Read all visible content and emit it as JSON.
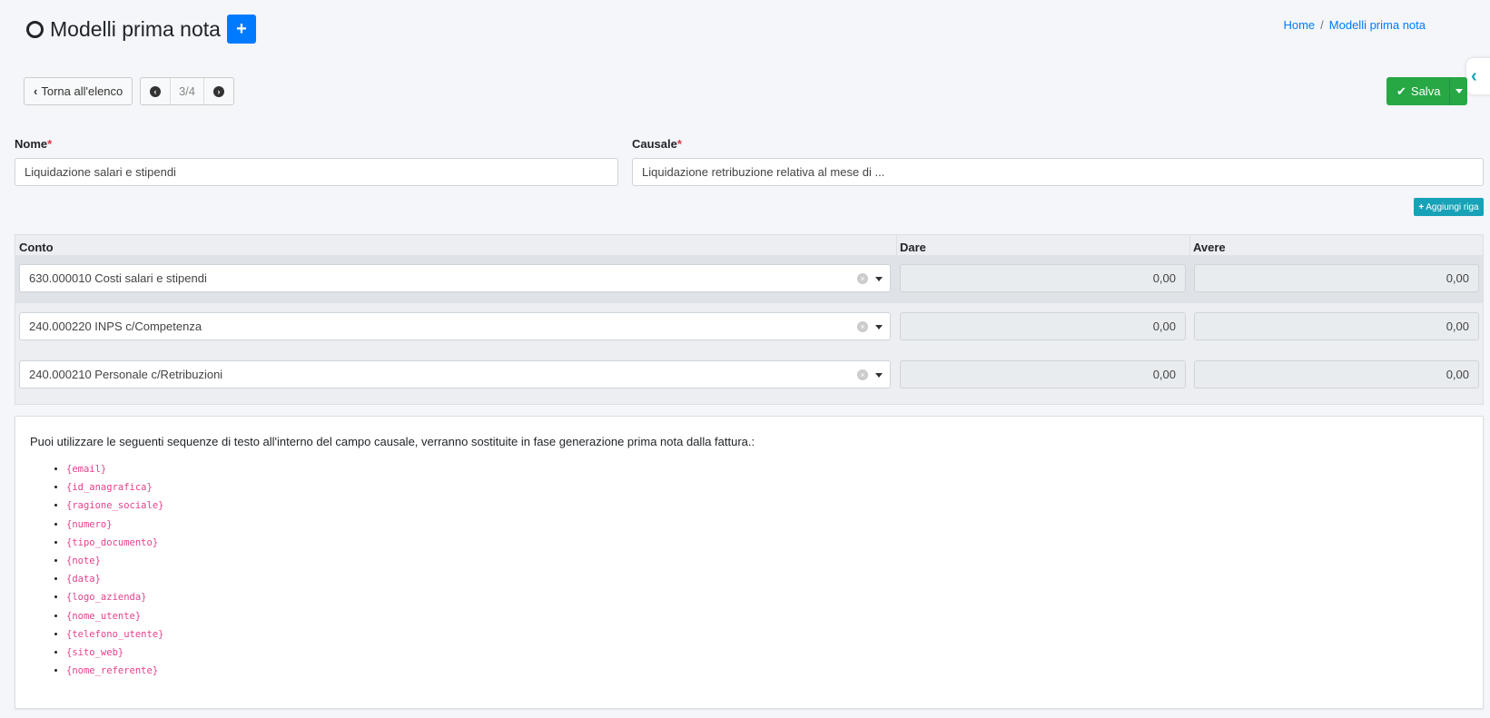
{
  "header": {
    "title": "Modelli prima nota",
    "add_button_label": "+",
    "breadcrumb": [
      {
        "label": "Home"
      },
      {
        "label": "Modelli prima nota"
      }
    ]
  },
  "toolbar": {
    "back_label": "Torna all'elenco",
    "pager_text": "3/4",
    "save_label": "Salva"
  },
  "form": {
    "nome": {
      "label": "Nome",
      "value": "Liquidazione salari e stipendi"
    },
    "causale": {
      "label": "Causale",
      "value": "Liquidazione retribuzione relativa al mese di ..."
    },
    "add_row_label": "Aggiungi riga"
  },
  "table": {
    "headers": {
      "conto": "Conto",
      "dare": "Dare",
      "avere": "Avere"
    },
    "rows": [
      {
        "conto": "630.000010 Costi salari e stipendi",
        "dare": "0,00",
        "avere": "0,00"
      },
      {
        "conto": "240.000220 INPS c/Competenza",
        "dare": "0,00",
        "avere": "0,00"
      },
      {
        "conto": "240.000210 Personale c/Retribuzioni",
        "dare": "0,00",
        "avere": "0,00"
      }
    ]
  },
  "info": {
    "text": "Puoi utilizzare le seguenti sequenze di testo all'interno del campo causale, verranno sostituite in fase generazione prima nota dalla fattura.:",
    "variables": [
      "{email}",
      "{id_anagrafica}",
      "{ragione_sociale}",
      "{numero}",
      "{tipo_documento}",
      "{note}",
      "{data}",
      "{logo_azienda}",
      "{nome_utente}",
      "{telefono_utente}",
      "{sito_web}",
      "{nome_referente}"
    ]
  },
  "colors": {
    "primary": "#007bff",
    "success": "#28a745",
    "info": "#17a2b8",
    "code": "#e83e8c",
    "required": "#dc3545"
  }
}
